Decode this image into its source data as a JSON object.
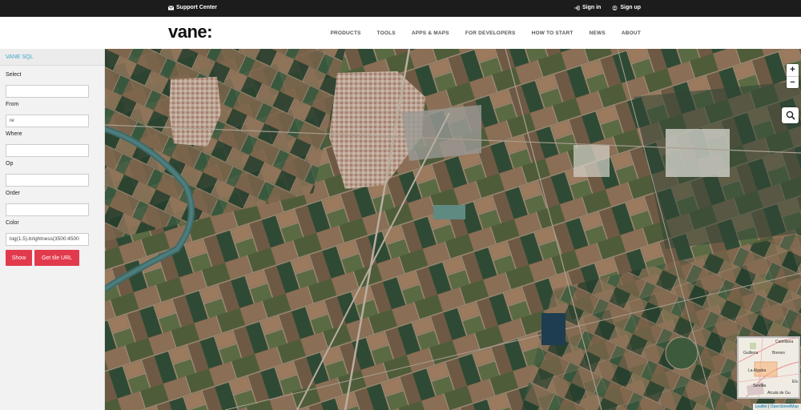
{
  "topbar": {
    "support_label": "Support Center",
    "signin_label": "Sign in",
    "signup_label": "Sign up"
  },
  "header": {
    "logo": "vane:",
    "nav": [
      "PRODUCTS",
      "TOOLS",
      "APPS & MAPS",
      "FOR DEVELOPERS",
      "HOW TO START",
      "NEWS",
      "ABOUT"
    ]
  },
  "sidebar": {
    "title": "VANE SQL",
    "fields": {
      "select": {
        "label": "Select",
        "value": ""
      },
      "from": {
        "label": "From",
        "value": "re"
      },
      "where": {
        "label": "Where",
        "value": ""
      },
      "op": {
        "label": "Op",
        "value": ""
      },
      "order": {
        "label": "Order",
        "value": ""
      },
      "color": {
        "label": "Color",
        "value": "log(1.5).brightness(3500:4500"
      }
    },
    "show_label": "Show",
    "tile_url_label": "Get tile URL"
  },
  "map": {
    "zoom_in": "+",
    "zoom_out": "−",
    "minimap_labels": [
      "Cantillana",
      "Guillena",
      "Brenes",
      "La Algaba",
      "Sevilla",
      "Alcalá de Gu",
      "Els"
    ],
    "attribution_leaflet": "Leaflet",
    "attribution_osm": "OpenStreetMap"
  },
  "colors": {
    "accent_red": "#e23a4d",
    "accent_blue": "#3aa7c9",
    "topbar_bg": "#1c1c1c"
  }
}
